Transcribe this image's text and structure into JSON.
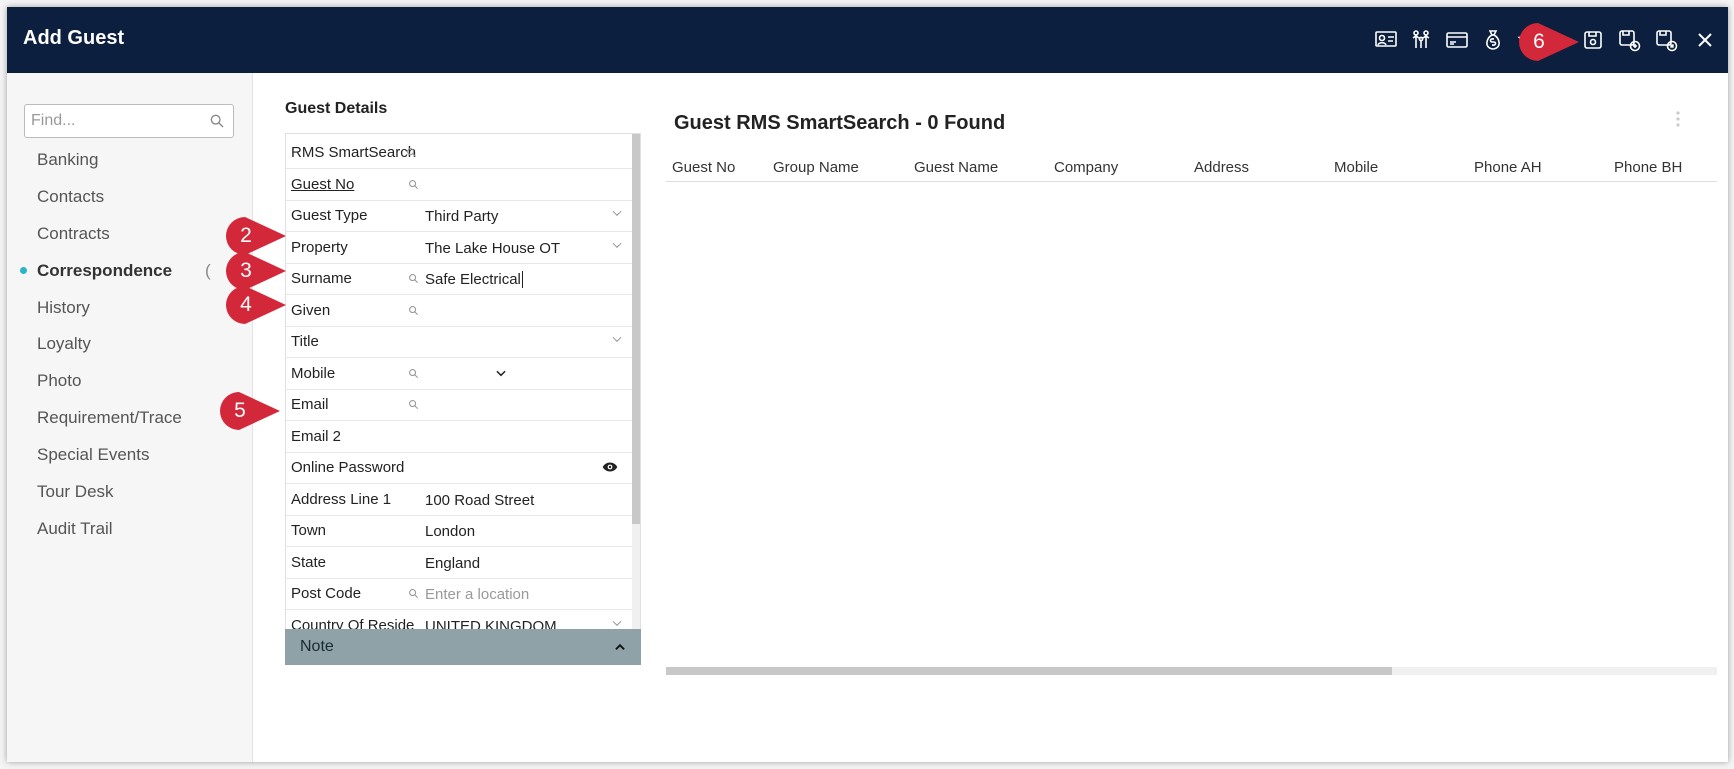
{
  "window": {
    "title": "Add Guest"
  },
  "toolbar": {
    "icons": [
      "guest-profile-icon",
      "family-icon",
      "card-icon",
      "money-bag-icon",
      "star-icon",
      "save-icon",
      "save-and-add-icon",
      "save-and-close-icon",
      "close-icon"
    ]
  },
  "sidebar": {
    "search_placeholder": "Find...",
    "items": [
      {
        "label": "Banking"
      },
      {
        "label": "Contacts"
      },
      {
        "label": "Contracts"
      },
      {
        "label": "Correspondence"
      },
      {
        "label": "History"
      },
      {
        "label": "Loyalty"
      },
      {
        "label": "Photo"
      },
      {
        "label": "Requirement/Trace"
      },
      {
        "label": "Special Events"
      },
      {
        "label": "Tour Desk"
      },
      {
        "label": "Audit Trail"
      }
    ],
    "active_item": "Correspondence",
    "active_trailing_glyph": "("
  },
  "guest_details": {
    "title": "Guest Details",
    "fields": [
      {
        "label": "RMS SmartSearch",
        "value": ""
      },
      {
        "label": "Guest No",
        "value": ""
      },
      {
        "label": "Guest Type",
        "value": "Third Party"
      },
      {
        "label": "Property",
        "value": "The Lake House OT"
      },
      {
        "label": "Surname",
        "value": "Safe Electrical"
      },
      {
        "label": "Given",
        "value": ""
      },
      {
        "label": "Title",
        "value": ""
      },
      {
        "label": "Mobile",
        "value": ""
      },
      {
        "label": "Email",
        "value": ""
      },
      {
        "label": "Email 2",
        "value": ""
      },
      {
        "label": "Online Password",
        "value": ""
      },
      {
        "label": "Address Line 1",
        "value": "100 Road Street"
      },
      {
        "label": "Town",
        "value": "London"
      },
      {
        "label": "State",
        "value": "England"
      },
      {
        "label": "Post Code",
        "value": "",
        "placeholder": "Enter a location"
      },
      {
        "label": "Country Of Reside",
        "value": "UNITED KINGDOM"
      }
    ],
    "note_label": "Note"
  },
  "results": {
    "title": "Guest RMS SmartSearch - 0 Found",
    "columns": [
      "Guest No",
      "Group Name",
      "Guest Name",
      "Company",
      "Address",
      "Mobile",
      "Phone AH",
      "Phone BH"
    ]
  },
  "callouts": [
    "2",
    "3",
    "4",
    "5",
    "6"
  ],
  "colors": {
    "header": "#0c1f3f",
    "callout": "#d3283a",
    "active_dot": "#2ab5c8",
    "note_bar": "#8fa2a8"
  }
}
